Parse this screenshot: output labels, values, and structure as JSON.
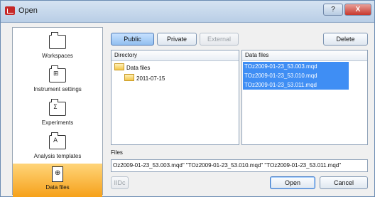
{
  "window": {
    "title": "Open",
    "help_glyph": "?",
    "close_glyph": "X"
  },
  "sidebar": {
    "items": [
      {
        "label": "Workspaces",
        "icon": "folder-icon",
        "glyph": ""
      },
      {
        "label": "Instrument settings",
        "icon": "instrument-settings-icon",
        "glyph": "⊞"
      },
      {
        "label": "Experiments",
        "icon": "experiments-icon",
        "glyph": "Σ"
      },
      {
        "label": "Analysis templates",
        "icon": "analysis-templates-icon",
        "glyph": "A"
      },
      {
        "label": "Data files",
        "icon": "data-files-icon",
        "glyph": "⊕"
      }
    ]
  },
  "toolbar": {
    "public_label": "Public",
    "private_label": "Private",
    "external_label": "External",
    "delete_label": "Delete"
  },
  "directory": {
    "header": "Directory",
    "tree": [
      {
        "label": "Data files"
      },
      {
        "label": "2011-07-15"
      }
    ]
  },
  "data_files": {
    "header": "Data files",
    "items": [
      "TOz2009-01-23_53.003.mqd",
      "TOz2009-01-23_53.010.mqd",
      "TOz2009-01-23_53.011.mqd"
    ]
  },
  "files": {
    "label": "Files",
    "value": "Oz2009-01-23_53.003.mqd\" \"TOz2009-01-23_53.010.mqd\" \"TOz2009-01-23_53.011.mqd\""
  },
  "footer": {
    "disabled_label": "IIDc",
    "open_label": "Open",
    "cancel_label": "Cancel"
  },
  "colors": {
    "selection": "#3f8ef4",
    "active_sidebar": "#f6a11a",
    "close_button": "#c7382d"
  }
}
